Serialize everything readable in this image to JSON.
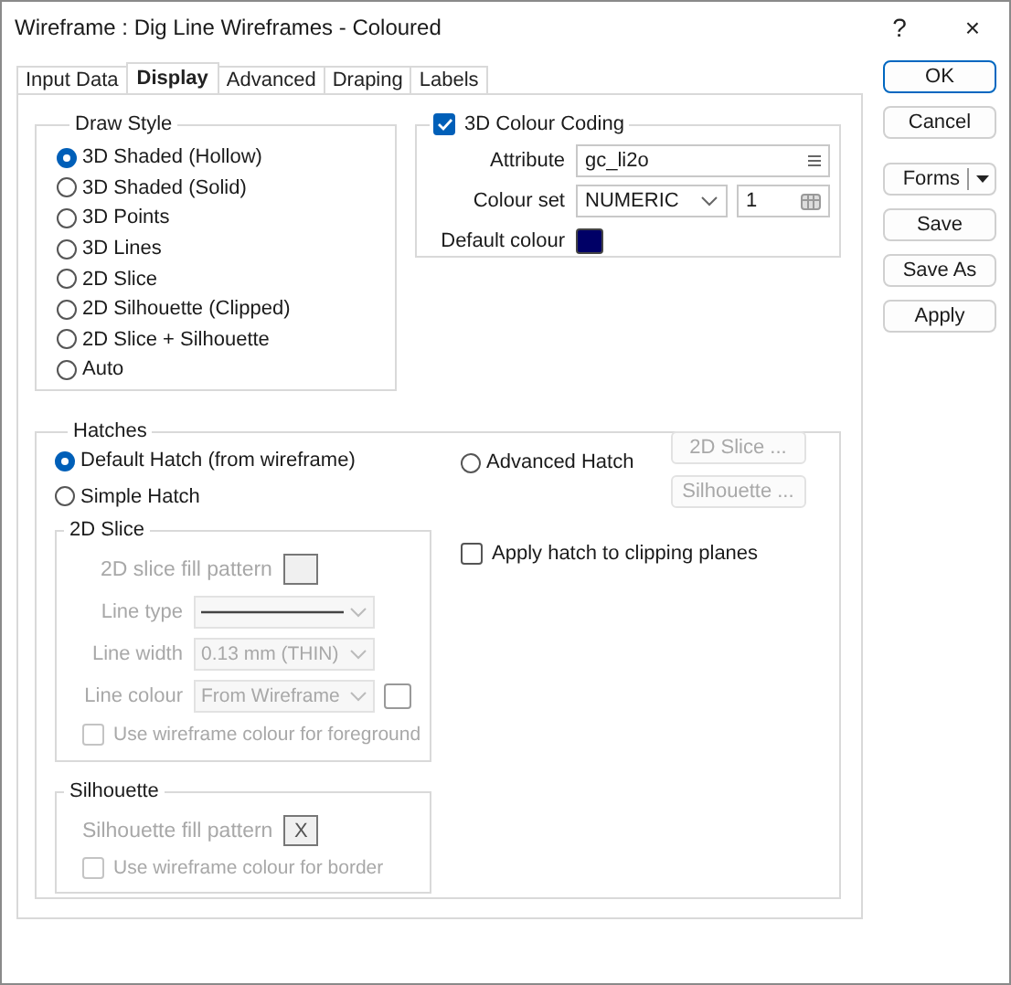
{
  "window": {
    "title": "Wireframe : Dig Line Wireframes - Coloured",
    "help": "?",
    "close": "×"
  },
  "tabs": [
    {
      "label": "Input Data",
      "selected": false
    },
    {
      "label": "Display",
      "selected": true
    },
    {
      "label": "Advanced",
      "selected": false
    },
    {
      "label": "Draping",
      "selected": false
    },
    {
      "label": "Labels",
      "selected": false
    }
  ],
  "draw_style": {
    "title": "Draw Style",
    "options": [
      {
        "label": "3D Shaded (Hollow)",
        "selected": true
      },
      {
        "label": "3D Shaded (Solid)",
        "selected": false
      },
      {
        "label": "3D Points",
        "selected": false
      },
      {
        "label": "3D Lines",
        "selected": false
      },
      {
        "label": "2D Slice",
        "selected": false
      },
      {
        "label": "2D Silhouette (Clipped)",
        "selected": false
      },
      {
        "label": "2D Slice + Silhouette",
        "selected": false
      },
      {
        "label": "Auto",
        "selected": false
      }
    ]
  },
  "colour_coding": {
    "title": "3D Colour Coding",
    "checked": true,
    "attribute": {
      "label": "Attribute",
      "value": "gc_li2o"
    },
    "colour_set": {
      "label": "Colour set",
      "value": "NUMERIC",
      "number": "1"
    },
    "default_colour": {
      "label": "Default colour",
      "color": "#000066"
    }
  },
  "hatches": {
    "title": "Hatches",
    "options": [
      {
        "label": "Default Hatch (from wireframe)",
        "selected": true
      },
      {
        "label": "Simple Hatch",
        "selected": false
      },
      {
        "label": "Advanced Hatch",
        "selected": false
      }
    ],
    "advanced_buttons": [
      {
        "label": "2D Slice ...",
        "disabled": true
      },
      {
        "label": "Silhouette ...",
        "disabled": true
      }
    ],
    "clipping": {
      "label": "Apply hatch to clipping planes",
      "checked": false
    },
    "slice": {
      "title": "2D Slice",
      "disabled": true,
      "fill_pattern": {
        "label": "2D slice fill pattern"
      },
      "line_type": {
        "label": "Line type"
      },
      "line_width": {
        "label": "Line width",
        "value": "0.13 mm (THIN)"
      },
      "line_colour": {
        "label": "Line colour",
        "value": "From Wireframe"
      },
      "use_colour": {
        "label": "Use wireframe colour for foreground",
        "checked": false
      }
    },
    "silhouette": {
      "title": "Silhouette",
      "disabled": true,
      "fill_pattern": {
        "label": "Silhouette fill pattern",
        "value": "X"
      },
      "use_colour": {
        "label": "Use wireframe colour for border",
        "checked": false
      }
    }
  },
  "buttons": [
    {
      "label": "OK",
      "kind": "primary"
    },
    {
      "label": "Cancel",
      "kind": "plain"
    },
    {
      "label": "Forms",
      "kind": "split"
    },
    {
      "label": "Save",
      "kind": "plain"
    },
    {
      "label": "Save As",
      "kind": "plain"
    },
    {
      "label": "Apply",
      "kind": "plain"
    }
  ]
}
